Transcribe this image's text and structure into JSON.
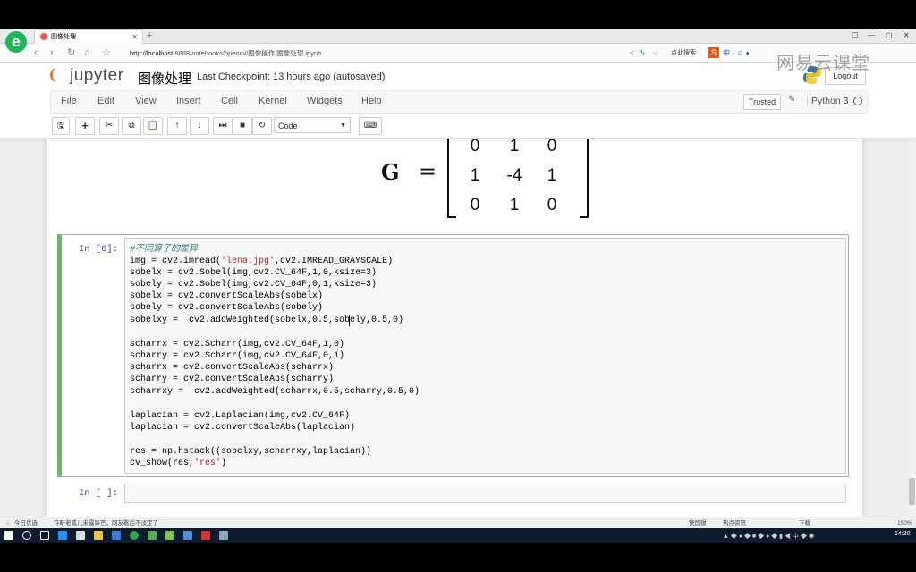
{
  "browser": {
    "tab_title": "图像处理",
    "new_tab": "+",
    "url_host": "http://localhost",
    "url_rest": ":8888/notebooks/opencv/图像操作/图像处理.ipynb",
    "search_label": "点此搜索",
    "status_left": "今日优选",
    "status_news": "许昕老狐儿未露锋芒，网友看后不淡定了",
    "status_right": "快剪辑",
    "status_hot": "热点资讯",
    "status_download": "下载",
    "zoom": "150%",
    "clock": "14:20"
  },
  "watermark": "网易云课堂",
  "jupyter": {
    "logo_text": "jupyter",
    "notebook_title": "图像处理",
    "checkpoint": "Last Checkpoint: 13 hours ago (autosaved)",
    "logout": "Logout",
    "trusted": "Trusted",
    "kernel": "Python 3",
    "cell_type": "Code",
    "menu": [
      "File",
      "Edit",
      "View",
      "Insert",
      "Cell",
      "Kernel",
      "Widgets",
      "Help"
    ]
  },
  "matrix": {
    "label": "G",
    "equals": "=",
    "rows": [
      [
        "0",
        "1",
        "0"
      ],
      [
        "1",
        "-4",
        "1"
      ],
      [
        "0",
        "1",
        "0"
      ]
    ]
  },
  "cells": {
    "cell6_prompt": "In [6]:",
    "empty_prompt": "In [ ]:",
    "code": {
      "comment": "#不同算子的差异",
      "l1a": "img = cv2.imread(",
      "l1s": "'lena.jpg'",
      "l1b": ",cv2.IMREAD_GRAYSCALE)",
      "l2": "sobelx = cv2.Sobel(img,cv2.CV_64F,1,0,ksize=3)",
      "l3": "sobely = cv2.Sobel(img,cv2.CV_64F,0,1,ksize=3)",
      "l4": "sobelx = cv2.convertScaleAbs(sobelx)",
      "l5": "sobely = cv2.convertScaleAbs(sobely)",
      "l6": "sobelxy =  cv2.addWeighted(sobelx,0.5,sobely,0.5,0)",
      "l7": "scharrx = cv2.Scharr(img,cv2.CV_64F,1,0)",
      "l8": "scharry = cv2.Scharr(img,cv2.CV_64F,0,1)",
      "l9": "scharrx = cv2.convertScaleAbs(scharrx)",
      "l10": "scharry = cv2.convertScaleAbs(scharry)",
      "l11": "scharrxy =  cv2.addWeighted(scharrx,0.5,scharry,0.5,0)",
      "l12": "laplacian = cv2.Laplacian(img,cv2.CV_64F)",
      "l13": "laplacian = cv2.convertScaleAbs(laplacian)",
      "l14": "res = np.hstack((sobelxy,scharrxy,laplacian))",
      "l15a": "cv_show(res,",
      "l15s": "'res'",
      "l15b": ")"
    }
  },
  "colors": {
    "selected_cell": "#66bb6a",
    "prompt": "#303f9f",
    "jupyter_orange": "#f37626"
  }
}
